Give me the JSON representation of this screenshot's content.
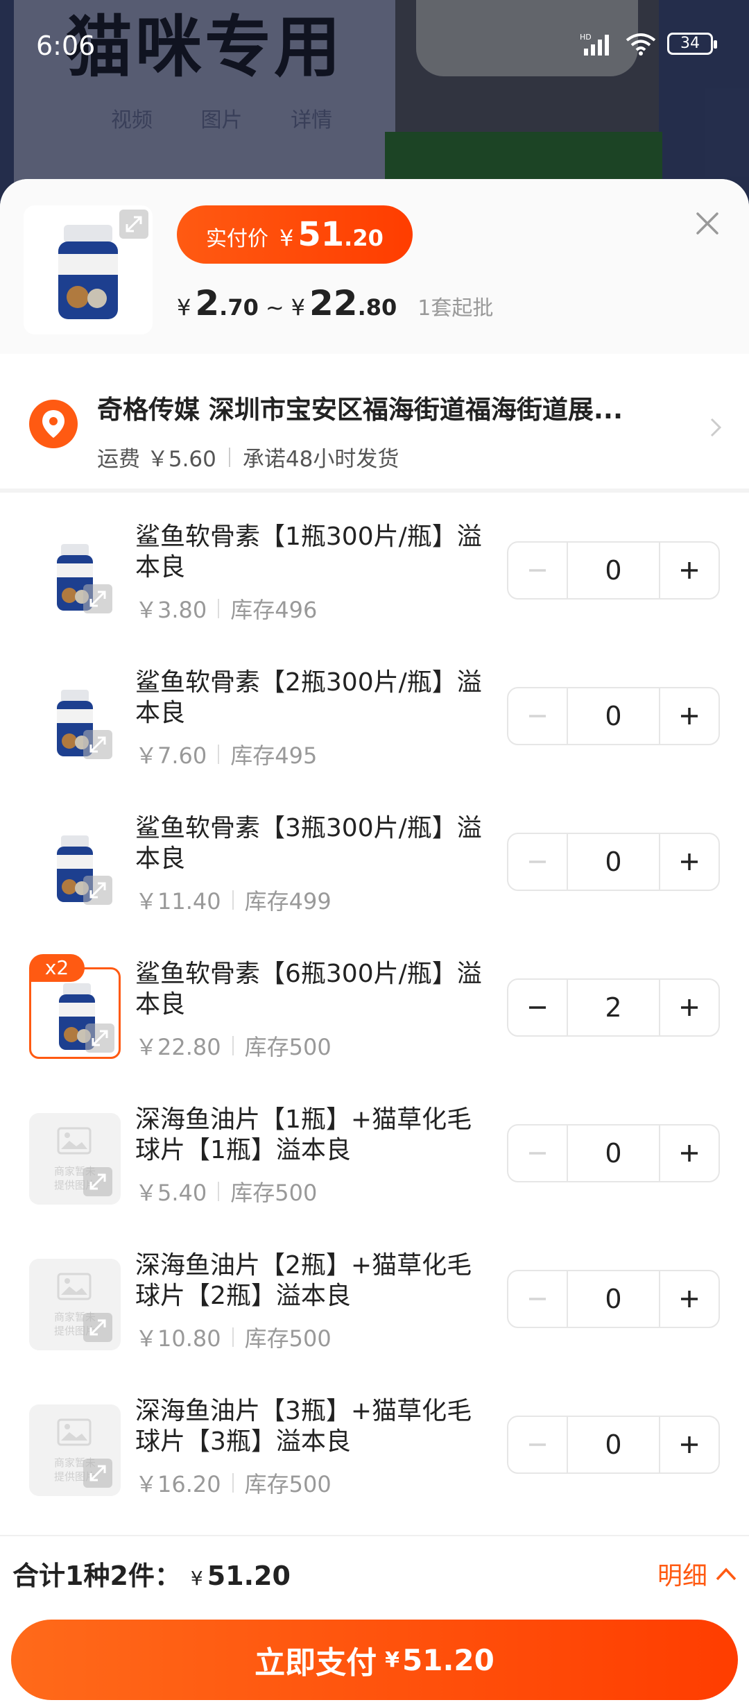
{
  "status_bar": {
    "time": "6:06",
    "battery": "34"
  },
  "background": {
    "headline": "猫咪专用",
    "tabs": [
      "视频",
      "图片",
      "详情"
    ]
  },
  "header": {
    "pay_label": "实付价",
    "currency": "¥",
    "pay_int": "51",
    "pay_dec": ".20",
    "range_low_int": "2",
    "range_low_dec": ".70",
    "range_sep": "~",
    "range_high_int": "22",
    "range_high_dec": ".80",
    "moq": "1套起批"
  },
  "address": {
    "text": "奇格传媒 深圳市宝安区福海街道福海街道展...",
    "shipping": "运费 ￥5.60",
    "promise": "承诺48小时发货"
  },
  "items": [
    {
      "title": "鲨鱼软骨素【1瓶300片/瓶】溢本良",
      "price": "￥3.80",
      "stock": "库存496",
      "qty": "0",
      "thumb": "bottle"
    },
    {
      "title": "鲨鱼软骨素【2瓶300片/瓶】溢本良",
      "price": "￥7.60",
      "stock": "库存495",
      "qty": "0",
      "thumb": "bottle"
    },
    {
      "title": "鲨鱼软骨素【3瓶300片/瓶】溢本良",
      "price": "￥11.40",
      "stock": "库存499",
      "qty": "0",
      "thumb": "bottle"
    },
    {
      "title": "鲨鱼软骨素【6瓶300片/瓶】溢本良",
      "price": "￥22.80",
      "stock": "库存500",
      "qty": "2",
      "thumb": "bottle",
      "badge": "x2"
    },
    {
      "title": "深海鱼油片【1瓶】+猫草化毛球片【1瓶】溢本良",
      "price": "￥5.40",
      "stock": "库存500",
      "qty": "0",
      "thumb": "placeholder"
    },
    {
      "title": "深海鱼油片【2瓶】+猫草化毛球片【2瓶】溢本良",
      "price": "￥10.80",
      "stock": "库存500",
      "qty": "0",
      "thumb": "placeholder"
    },
    {
      "title": "深海鱼油片【3瓶】+猫草化毛球片【3瓶】溢本良",
      "price": "￥16.20",
      "stock": "库存500",
      "qty": "0",
      "thumb": "placeholder"
    }
  ],
  "placeholder_text": "商家暂未提供图片",
  "footer": {
    "total_label": "合计1种2件：",
    "currency": "¥",
    "total_amount": "51.20",
    "detail_label": "明细",
    "pay_label": "立即支付",
    "pay_amount": "51.20"
  },
  "colors": {
    "accent": "#ff5a12",
    "pay_gradient_end": "#ff3d00"
  }
}
